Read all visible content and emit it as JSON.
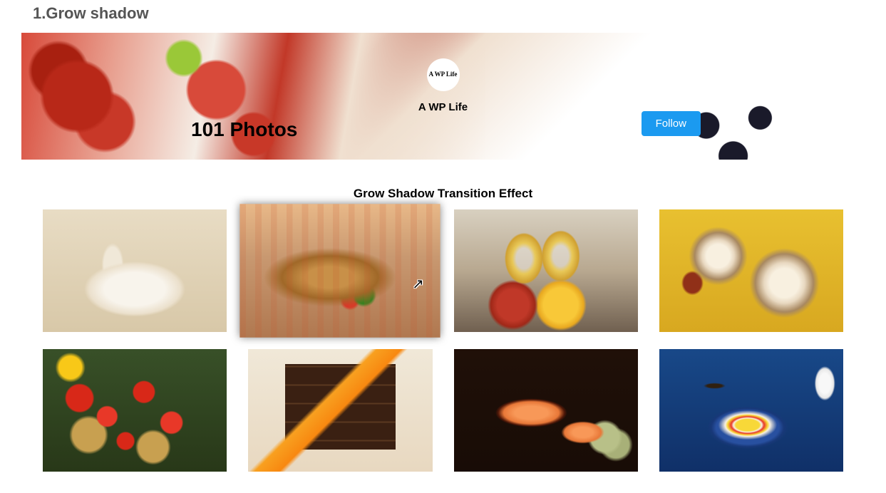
{
  "section": {
    "title": "1.Grow shadow"
  },
  "banner": {
    "avatar_text": "A WP Life",
    "profile_name": "A WP Life",
    "photo_count": "101 Photos",
    "follow_label": "Follow"
  },
  "effect": {
    "title": "Grow Shadow Transition Effect"
  },
  "gallery": {
    "items": [
      {
        "name": "eggs-and-feather"
      },
      {
        "name": "sandwich-plate"
      },
      {
        "name": "champagne-apple-orange"
      },
      {
        "name": "candles-leaves"
      },
      {
        "name": "tomato-baskets-market"
      },
      {
        "name": "chocolate-cake-slices"
      },
      {
        "name": "papaya-pears"
      },
      {
        "name": "cereal-bowl-milk"
      }
    ],
    "hovered_index": 1
  }
}
